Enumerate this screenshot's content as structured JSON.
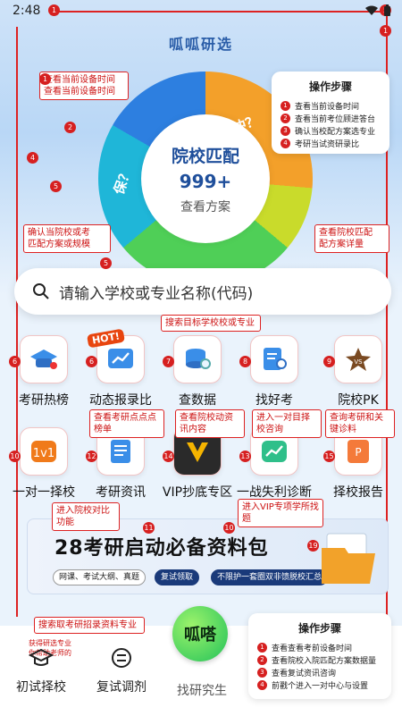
{
  "status": {
    "time": "2:48"
  },
  "hero": {
    "title": "呱呱研选",
    "center_title": "院校匹配",
    "center_count": "999+",
    "center_link": "查看方案",
    "seg_right": "冲？",
    "seg_left": "保？"
  },
  "callouts": {
    "c1": "查看当前设备时间\n查看当前设备时间",
    "c6": "确认当院校或考\n匹配方案或规模",
    "c8": "查看院校匹配\n配方案详量",
    "c_search": "搜索目标学校校或专业",
    "c_calc": "查看考研点点点榜单",
    "c_data": "查看院校动资讯内容",
    "c_find": "进入一对目择校咨询",
    "c_pk": "查询考研和关键诊料",
    "c_school": "进入院校对比功能",
    "c_vip": "进入VIP专项学所找题",
    "c_bottom": "搜索取考研招录资料专业"
  },
  "steps_top": {
    "title": "操作步骤",
    "items": [
      "查看当前设备时间",
      "查看当前考位顾进答台",
      "确认当校配方案选专业",
      "考研当试资研录比"
    ]
  },
  "search": {
    "placeholder": "请输入学校或专业名称(代码)"
  },
  "grid_row1": [
    {
      "label": "考研热榜",
      "num": "6"
    },
    {
      "label": "动态报录比",
      "num": "6"
    },
    {
      "label": "查数据",
      "num": "7"
    },
    {
      "label": "找好考",
      "num": "8"
    },
    {
      "label": "院校PK",
      "num": "9"
    }
  ],
  "grid_row2": [
    {
      "label": "一对一择校",
      "num": "10"
    },
    {
      "label": "考研资讯",
      "num": "12"
    },
    {
      "label": "VIP抄底专区",
      "num": "14"
    },
    {
      "label": "一战失利诊断",
      "num": "13"
    },
    {
      "label": "择校报告",
      "num": "15"
    }
  ],
  "banner": {
    "title": "28考研启动必备资料包",
    "pill1": "网课、考试大纲、真题",
    "pill2": "复试领取",
    "pill3": "不限护一套圈双非馈脱校汇总"
  },
  "steps_bottom": {
    "title": "操作步骤",
    "items": [
      "查看查看考前设备时间",
      "查看院校入院匹配方案数据量",
      "查看复试资讯咨询",
      "前戳个进入一对中心与设置"
    ]
  },
  "left_note": "获得研选专业\n你帮助老师的",
  "tabbar": {
    "tab1": "初试择校",
    "tab2": "复试调剂",
    "center": "呱嗒",
    "tab3": "找研究生"
  },
  "colors": {
    "accent": "#d62020",
    "brand": "#2a5da8",
    "green": "#22c25a"
  }
}
